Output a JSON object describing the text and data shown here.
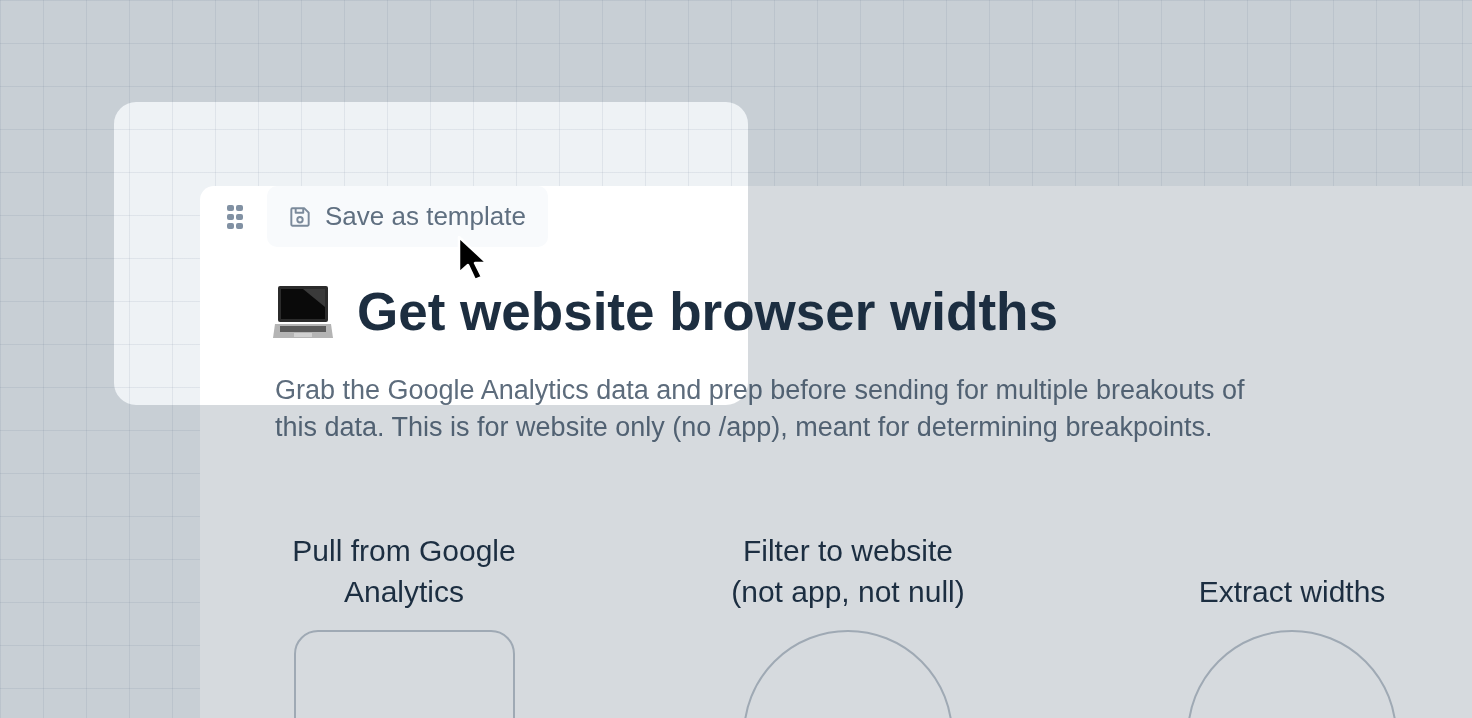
{
  "toolbar": {
    "save_button": {
      "label": "Save as template"
    }
  },
  "page": {
    "title": "Get website browser widths",
    "description": "Grab the Google Analytics data and prep before sending for multiple breakouts of this data. This is for website only (no /app), meant for determining breakpoints."
  },
  "steps": [
    {
      "title_lines": [
        "Pull from Google",
        "Analytics"
      ],
      "kind": "source"
    },
    {
      "title_lines": [
        "Filter to website",
        "(not app, not null)"
      ],
      "kind": "process"
    },
    {
      "title_lines": [
        "Extract widths"
      ],
      "kind": "process"
    }
  ]
}
